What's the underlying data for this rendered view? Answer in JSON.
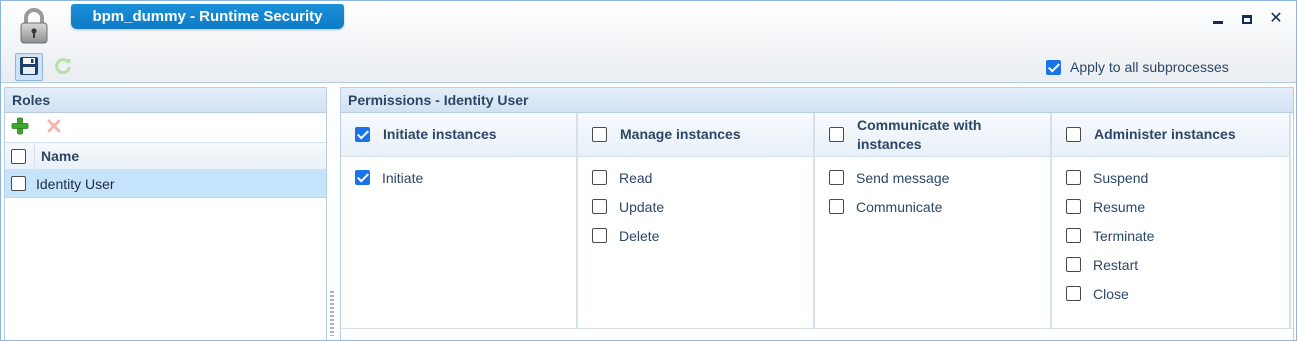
{
  "window": {
    "title": "bpm_dummy - Runtime Security",
    "app_icon": "lock-icon",
    "controls": [
      "minimize-icon",
      "maximize-icon",
      "close-icon"
    ]
  },
  "toolbar": {
    "save_icon": "floppy-disk-icon",
    "refresh_icon": "refresh-icon",
    "apply_all": {
      "label": "Apply to all subprocesses",
      "checked": true
    }
  },
  "roles": {
    "title": "Roles",
    "add_icon": "plus-icon",
    "delete_icon": "delete-x-icon",
    "column_name": "Name",
    "rows": [
      {
        "label": "Identity User",
        "checked": false,
        "selected": true
      }
    ]
  },
  "permissions": {
    "title": "Permissions - Identity User",
    "groups": [
      {
        "label": "Initiate instances",
        "checked": true,
        "items": [
          {
            "label": "Initiate",
            "checked": true
          }
        ]
      },
      {
        "label": "Manage instances",
        "checked": false,
        "items": [
          {
            "label": "Read",
            "checked": false
          },
          {
            "label": "Update",
            "checked": false
          },
          {
            "label": "Delete",
            "checked": false
          }
        ]
      },
      {
        "label": "Communicate with instances",
        "checked": false,
        "items": [
          {
            "label": "Send message",
            "checked": false
          },
          {
            "label": "Communicate",
            "checked": false
          }
        ]
      },
      {
        "label": "Administer instances",
        "checked": false,
        "items": [
          {
            "label": "Suspend",
            "checked": false
          },
          {
            "label": "Resume",
            "checked": false
          },
          {
            "label": "Terminate",
            "checked": false
          },
          {
            "label": "Restart",
            "checked": false
          },
          {
            "label": "Close",
            "checked": false
          }
        ]
      }
    ]
  },
  "colors": {
    "title_tab": "#0e7bc6",
    "accent_blue": "#1a73e8",
    "selected_row": "#c5e3fa",
    "header_text": "#2c4766"
  }
}
